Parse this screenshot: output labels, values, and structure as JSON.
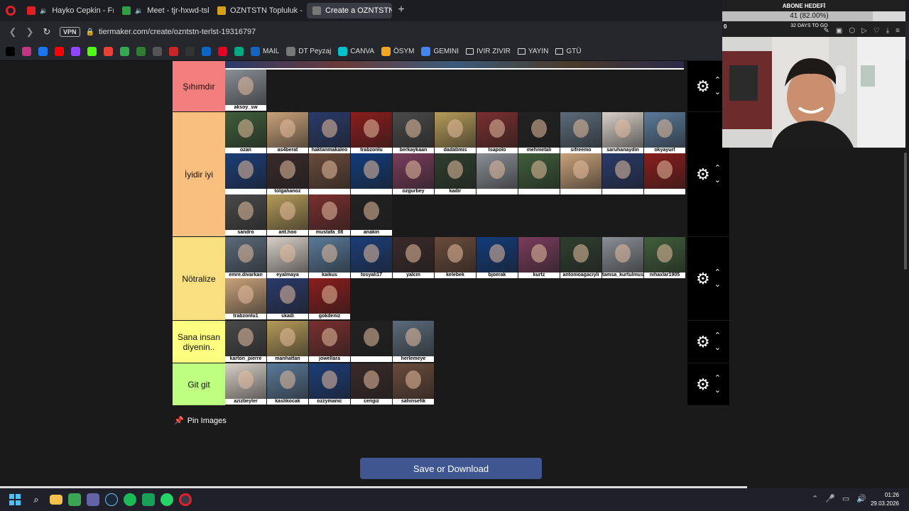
{
  "browser": {
    "tabs": [
      {
        "label": "Hayko Cepkin - Fırtına",
        "fav": "#e02020",
        "active": false,
        "audio": true
      },
      {
        "label": "Meet - tjr-hxwd-tsk",
        "fav": "#2f9e44",
        "active": false,
        "audio": true
      },
      {
        "label": "OZNTSTN Topluluk - Tier L",
        "fav": "#d4a017",
        "active": false,
        "audio": false
      },
      {
        "label": "Create a OZNTSTN TİERLİ",
        "fav": "#777777",
        "active": true,
        "audio": false
      }
    ],
    "new_tab_glyph": "+",
    "vpn_label": "VPN",
    "url": "tiermaker.com/create/ozntstn-terlst-19316797",
    "bookmarks": [
      {
        "label": "",
        "color": "#000000"
      },
      {
        "label": "",
        "color": "#c13584"
      },
      {
        "label": "",
        "color": "#1877f2"
      },
      {
        "label": "",
        "color": "#ff0000"
      },
      {
        "label": "",
        "color": "#9146ff"
      },
      {
        "label": "",
        "color": "#53fc18"
      },
      {
        "label": "",
        "color": "#ea4335"
      },
      {
        "label": "",
        "color": "#34a853"
      },
      {
        "label": "",
        "color": "#2e7d32"
      },
      {
        "label": "",
        "color": "#555555"
      },
      {
        "label": "",
        "color": "#c62828"
      },
      {
        "label": "",
        "color": "#333333"
      },
      {
        "label": "",
        "color": "#0a66c2"
      },
      {
        "label": "",
        "color": "#e60023"
      },
      {
        "label": "",
        "color": "#00a884"
      },
      {
        "label": "MAIL",
        "color": "#1565c0"
      },
      {
        "label": "DT Peyzaj",
        "color": "#777777"
      },
      {
        "label": "CANVA",
        "color": "#00c4cc"
      },
      {
        "label": "ÖSYM",
        "color": "#f5a623"
      },
      {
        "label": "GEMINI",
        "color": "#4285f4"
      }
    ],
    "folders": [
      "IVIR ZIVIR",
      "YAYIN",
      "GTÜ"
    ]
  },
  "tiers": [
    {
      "label": "Şıhımdır",
      "color": "#f27e7e",
      "captions": [
        "aksoy_sw"
      ],
      "top_strip": true
    },
    {
      "label": "İyidir iyi",
      "color": "#f8bf7f",
      "captions": [
        "ozan",
        "as4berat",
        "haktanmakaleo",
        "trabzonlu",
        "berkaykaan",
        "dadatimis",
        "tsapolo",
        "mehmetali",
        "sifreemo",
        "saruhanaydin",
        "okyayurt",
        "",
        "tolgahanoz",
        "",
        "",
        "ozgurbey",
        "kadir",
        "",
        "",
        "",
        "",
        "",
        "sandro",
        "ant.hoo",
        "mustafa_08",
        "anakin"
      ],
      "top_strip": false
    },
    {
      "label": "Nötralize",
      "color": "#f9df7f",
      "captions": [
        "emre.divarkan",
        "eyalmaya",
        "kaikus",
        "tosyali17",
        "yalcin",
        "kelebek",
        "bjoerak",
        "kurtz",
        "antonioagaciyli",
        "tamsa_kurtulmus",
        "nihaxlar1905",
        "trabzonlu1",
        "skadi",
        "gokdeniz"
      ],
      "top_strip": false
    },
    {
      "label": "Sana insan diyenin..",
      "color": "#fdfd7f",
      "captions": [
        "karton_pierre",
        "manhattan",
        "jowellara",
        "",
        "herlemeye"
      ],
      "top_strip": false
    },
    {
      "label": "Git git",
      "color": "#bdfd7f",
      "captions": [
        "azizbeyler",
        "kaslikocak",
        "ozzymanic",
        "cengiz",
        "sahinsefik"
      ],
      "top_strip": false
    }
  ],
  "tiles_palette": [
    "#8a8f96",
    "#3f5e3a",
    "#c9a27a",
    "#2a3b6b",
    "#8b1d1d",
    "#4a4a4a",
    "#b59b5a",
    "#7a2f2f",
    "#222222",
    "#5b6b7a",
    "#d8d0c8",
    "#5a7a9a",
    "#1c3e7a",
    "#3a2a2a",
    "#6b4b3b",
    "#123c7c",
    "#7a3c5c",
    "#2f3f2f"
  ],
  "page": {
    "pin_label": "Pin Images",
    "save_label": "Save or Download"
  },
  "overlay": {
    "title": "ABONE HEDEFİ",
    "progress_text": "41 (82.00%)",
    "progress_fraction": 0.82,
    "sub_text": "32 DAYS TO GO",
    "start_value": "0"
  },
  "taskbar": {
    "time": "01:26",
    "date": "29.03.2026"
  }
}
